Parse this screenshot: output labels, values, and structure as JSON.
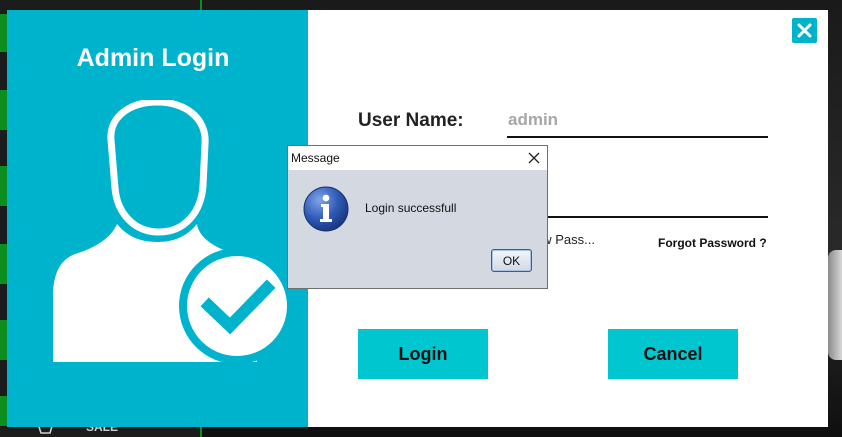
{
  "login": {
    "title": "Admin Login",
    "username_label": "User Name:",
    "username_value": "admin",
    "password_value": "****",
    "show_password_label": "ow Pass...",
    "forgot_password": "Forgot Password ?",
    "login_button": "Login",
    "cancel_button": "Cancel"
  },
  "dialog": {
    "title": "Message",
    "message": "Login successfull",
    "ok_button": "OK"
  },
  "background": {
    "bottom_text": "SALE"
  },
  "colors": {
    "accent": "#00b3cd",
    "button": "#00c7cf",
    "dialog_bg": "#d4d9e1"
  },
  "icons": {
    "avatar": "user-check-icon",
    "close": "close-icon",
    "info": "info-icon"
  }
}
